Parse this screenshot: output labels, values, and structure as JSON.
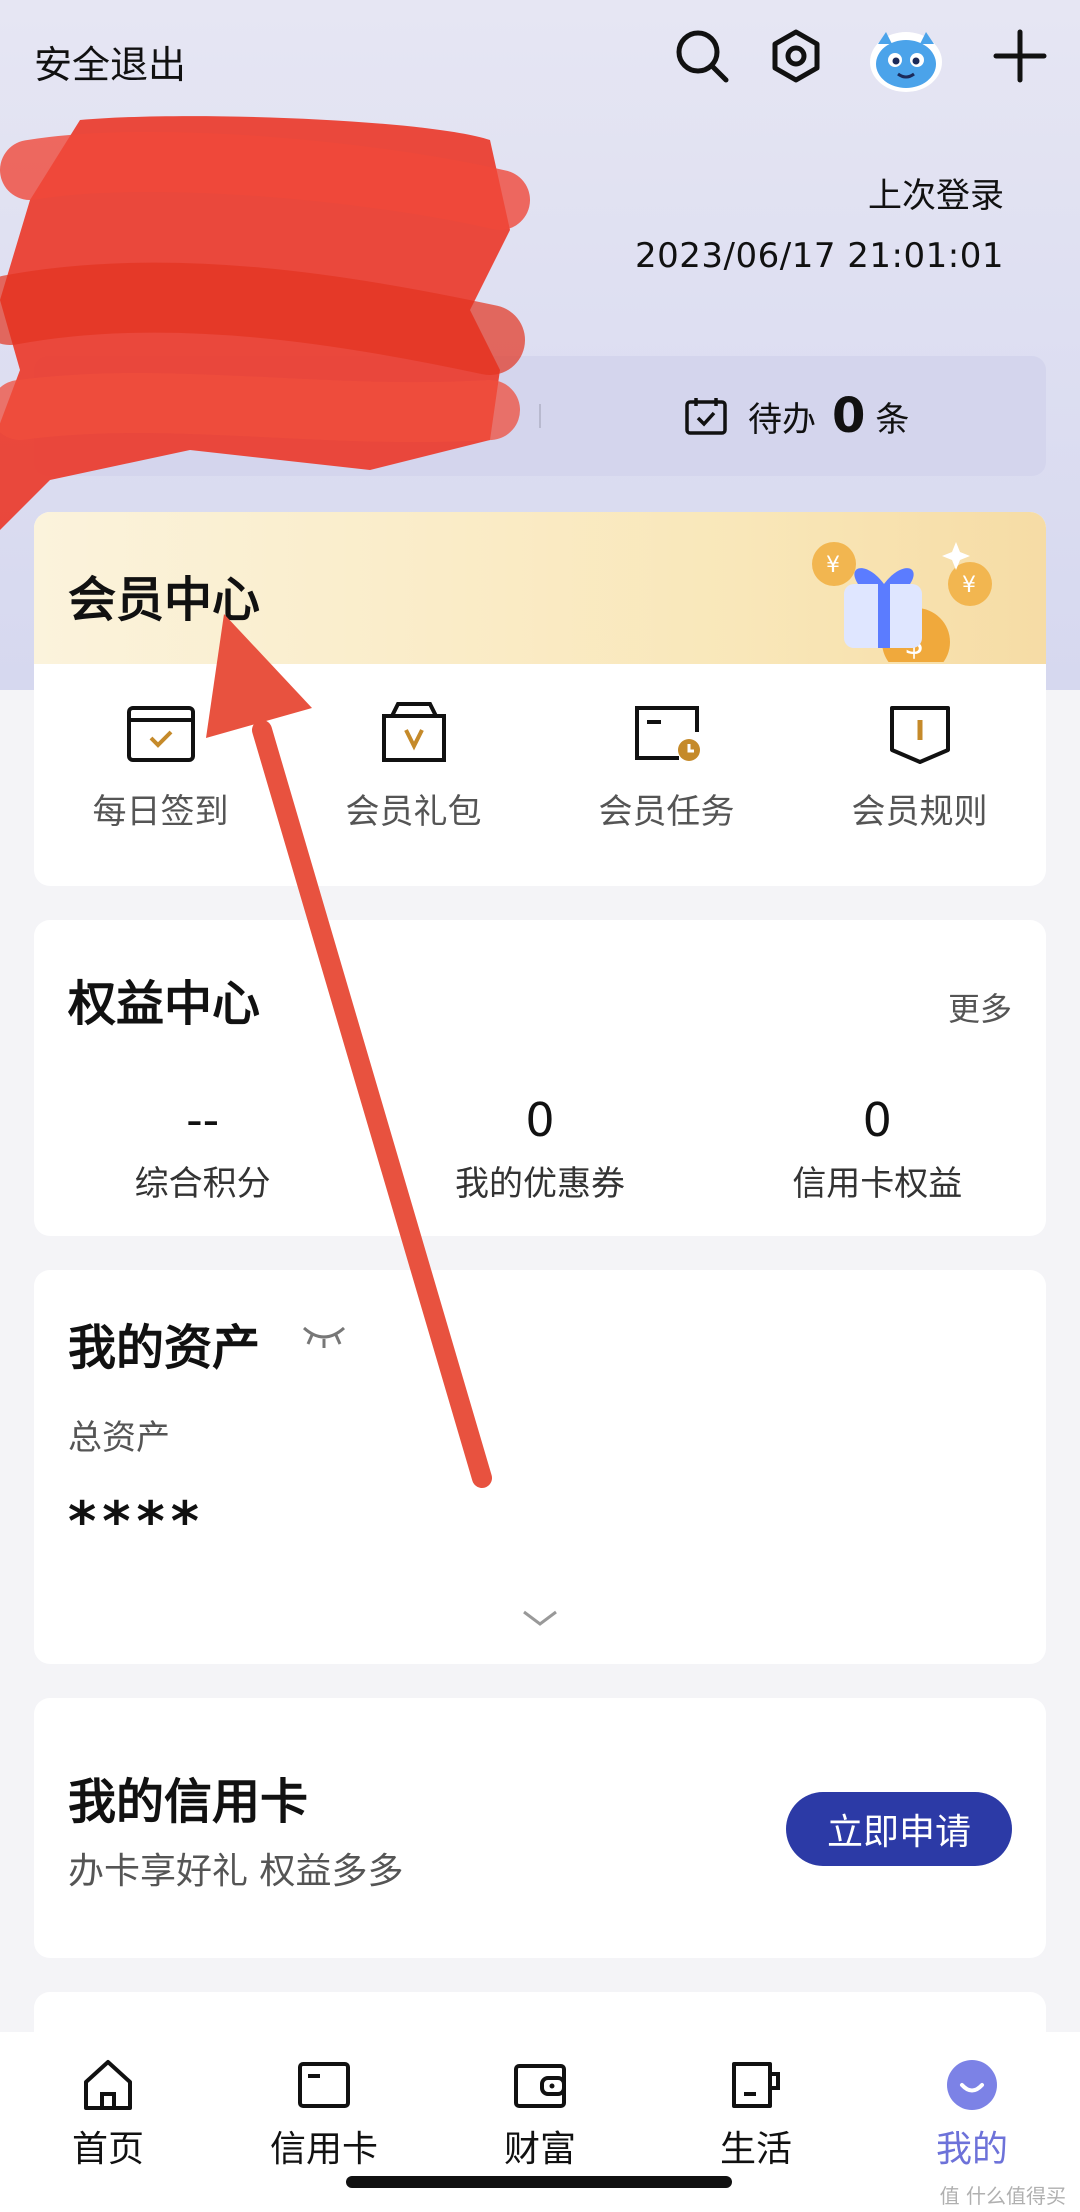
{
  "header": {
    "logout_label": "安全退出",
    "last_login_label": "上次登录",
    "last_login_time": "2023/06/17 21:01:01"
  },
  "stats": {
    "todo_label": "待办",
    "todo_count": "0",
    "todo_unit": "条"
  },
  "member": {
    "title": "会员中心",
    "items": [
      {
        "label": "每日签到",
        "icon": "checkin-icon"
      },
      {
        "label": "会员礼包",
        "icon": "gift-bag-icon"
      },
      {
        "label": "会员任务",
        "icon": "task-icon"
      },
      {
        "label": "会员规则",
        "icon": "rules-book-icon"
      }
    ]
  },
  "rights": {
    "title": "权益中心",
    "more": "更多",
    "items": [
      {
        "value": "--",
        "label": "综合积分"
      },
      {
        "value": "0",
        "label": "我的优惠券"
      },
      {
        "value": "0",
        "label": "信用卡权益"
      }
    ]
  },
  "assets": {
    "title": "我的资产",
    "total_label": "总资产",
    "total_value": "****"
  },
  "credit": {
    "title": "我的信用卡",
    "subtitle": "办卡享好礼 权益多多",
    "apply_label": "立即申请"
  },
  "tabbar": {
    "items": [
      {
        "label": "首页",
        "icon": "home-icon"
      },
      {
        "label": "信用卡",
        "icon": "credit-card-icon"
      },
      {
        "label": "财富",
        "icon": "wallet-icon"
      },
      {
        "label": "生活",
        "icon": "cup-icon"
      },
      {
        "label": "我的",
        "icon": "profile-icon"
      }
    ]
  },
  "watermark": "值 什么值得买",
  "colors": {
    "accent": "#2c3aa6",
    "tab_active": "#6d72d9",
    "gold": "#c58a2a",
    "annotation_arrow": "#e8523f",
    "redaction": "#ea3b2c"
  }
}
